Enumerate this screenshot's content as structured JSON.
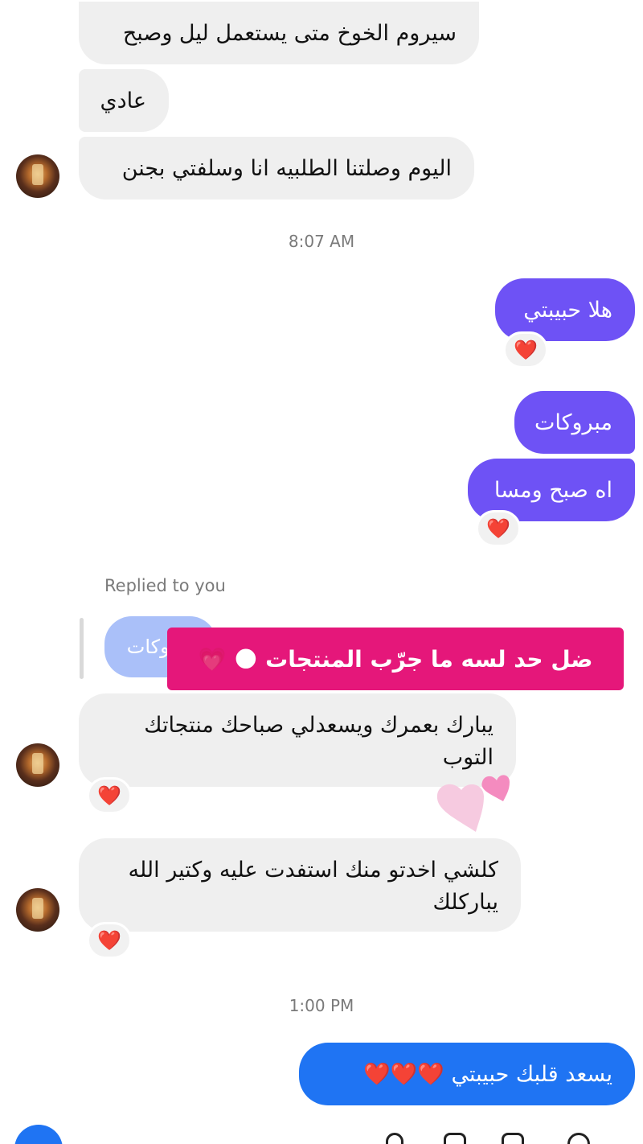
{
  "messages_top": [
    {
      "text": "سيروم الخوخ متى يستعمل ليل وصبح"
    },
    {
      "text": "عادي"
    },
    {
      "text": "اليوم وصلتنا الطلبيه انا وسلفتي بجنن"
    }
  ],
  "timestamps": {
    "first": "8:07 AM",
    "second": "1:00 PM"
  },
  "outgoing": [
    {
      "text": "هلا حبيبتي"
    },
    {
      "text": "مبروكات"
    },
    {
      "text": "اه صبح ومسا"
    }
  ],
  "reaction": "❤️",
  "reply": {
    "label": "Replied to you",
    "quoted": "مبروكات"
  },
  "story_sticker": {
    "text": "ضل حد لسه ما جرّب المنتجات 🌑 💗"
  },
  "messages_bottom": [
    {
      "text": "يبارك بعمرك ويسعدلي صباحك منتجاتك التوب"
    },
    {
      "text": "كلشي اخدتو منك استفدت عليه وكتير الله يباركلك"
    }
  ],
  "final_outgoing": {
    "text": "يسعد قلبك حبيبتي ❤️❤️❤️"
  },
  "colors": {
    "outgoing_purple": "#6e52f5",
    "outgoing_blue": "#1f74f3",
    "incoming_gray": "#efefef",
    "sticker_pink": "#e5177a",
    "heart_red": "#e0241f"
  },
  "icons": [
    "camera-icon",
    "mic-icon",
    "gallery-icon",
    "sticker-icon",
    "emoji-icon"
  ]
}
